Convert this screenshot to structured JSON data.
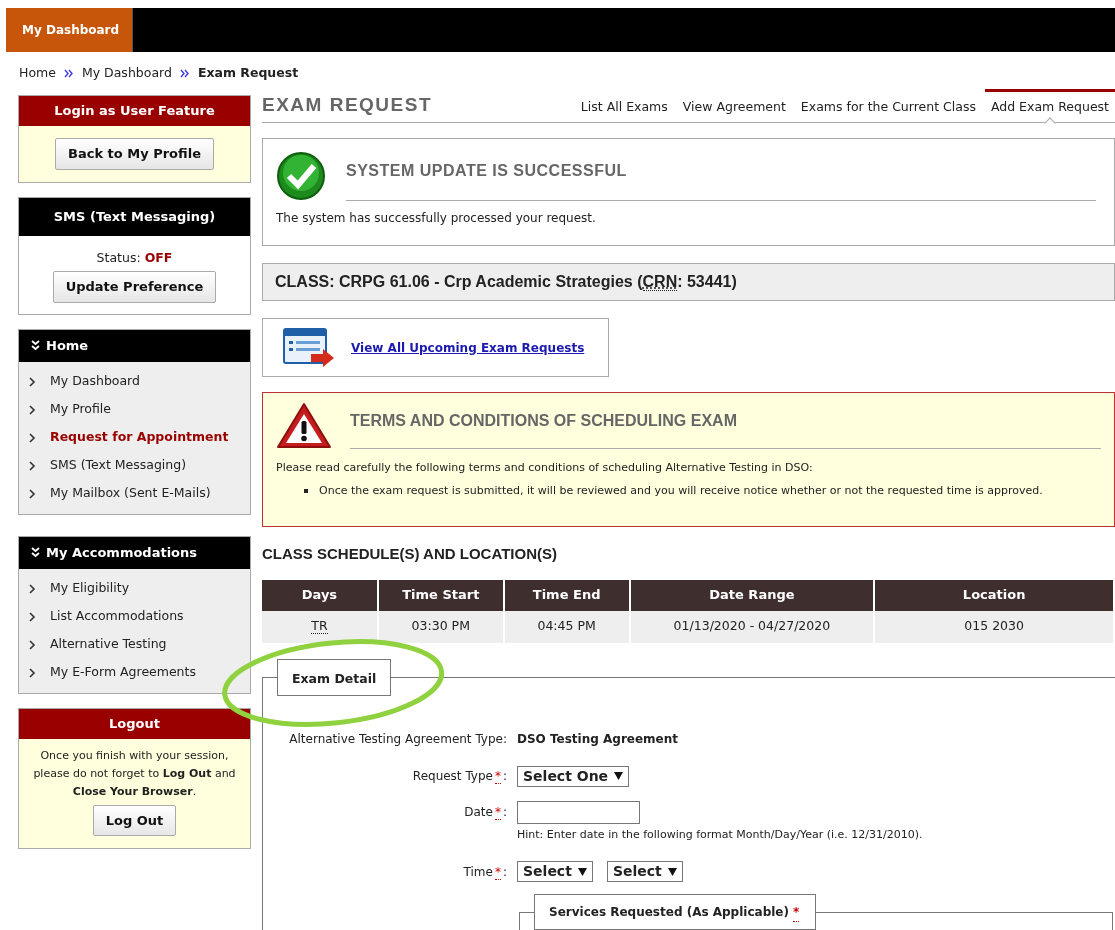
{
  "top_nav": [
    {
      "label": "My Dashboard",
      "selected": true
    }
  ],
  "breadcrumb": [
    "Home",
    "My Dashboard",
    "Exam Request"
  ],
  "sidebar": {
    "login_box": {
      "title": "Login as User Feature",
      "button": "Back to My Profile"
    },
    "sms_box": {
      "title": "SMS (Text Messaging)",
      "status_label": "Status:",
      "status_value": "OFF",
      "button": "Update Preference"
    },
    "menus": [
      {
        "title": "Home",
        "items": [
          {
            "label": "My Dashboard",
            "selected": false
          },
          {
            "label": "My Profile",
            "selected": false
          },
          {
            "label": "Request for Appointment",
            "selected": true
          },
          {
            "label": "SMS (Text Messaging)",
            "selected": false
          },
          {
            "label": "My Mailbox (Sent E-Mails)",
            "selected": false
          }
        ]
      },
      {
        "title": "My Accommodations",
        "items": [
          {
            "label": "My Eligibility",
            "selected": false
          },
          {
            "label": "List Accommodations",
            "selected": false
          },
          {
            "label": "Alternative Testing",
            "selected": false
          },
          {
            "label": "My E-Form Agreements",
            "selected": false
          }
        ]
      }
    ],
    "logout_box": {
      "title": "Logout",
      "message": "Once you finish with your session, please do not forget to **Log Out** and **Close Your Browser**.",
      "button": "Log Out"
    }
  },
  "page_title": "EXAM REQUEST",
  "tabs": [
    {
      "label": "List All Exams",
      "selected": false
    },
    {
      "label": "View Agreement",
      "selected": false
    },
    {
      "label": "Exams for the Current Class",
      "selected": false
    },
    {
      "label": "Add Exam Request",
      "selected": true
    }
  ],
  "success_message": {
    "title": "SYSTEM UPDATE IS SUCCESSFUL",
    "text": "The system has successfully processed your request."
  },
  "class_bar": {
    "prefix": "CLASS: CRPG 61.06 - Crp Academic Strategies (",
    "abbr": "CRN",
    "suffix": ": 53441)"
  },
  "upcoming_link": "View All Upcoming Exam Requests",
  "terms": {
    "title": "TERMS AND CONDITIONS OF SCHEDULING EXAM",
    "intro": "Please read carefully the following terms and conditions of scheduling Alternative Testing in DSO:",
    "bullets": [
      "Once the exam request is submitted, it will be reviewed and you will receive notice whether or not the requested time is approved."
    ]
  },
  "schedule": {
    "heading": "CLASS SCHEDULE(S) AND LOCATION(S)",
    "columns": [
      "Days",
      "Time Start",
      "Time End",
      "Date Range",
      "Location"
    ],
    "rows": [
      [
        "TR",
        "03:30 PM",
        "04:45 PM",
        "01/13/2020 - 04/27/2020",
        "015 2030"
      ]
    ]
  },
  "exam_detail": {
    "legend": "Exam Detail",
    "agreement_label": "Alternative Testing Agreement Type:",
    "agreement_value": "DSO Testing Agreement",
    "request_type": {
      "label": "Request Type",
      "required": "*",
      "colon": ":",
      "value": "Select One"
    },
    "date": {
      "label": "Date",
      "required": "*",
      "colon": ":",
      "hint": "Hint: Enter date in the following format Month/Day/Year (i.e. 12/31/2010)."
    },
    "time": {
      "label": "Time",
      "required": "*",
      "colon": ":",
      "values": [
        "Select",
        "Select"
      ]
    },
    "services": {
      "legend": "Services Requested (As Applicable)",
      "required": "*"
    }
  }
}
